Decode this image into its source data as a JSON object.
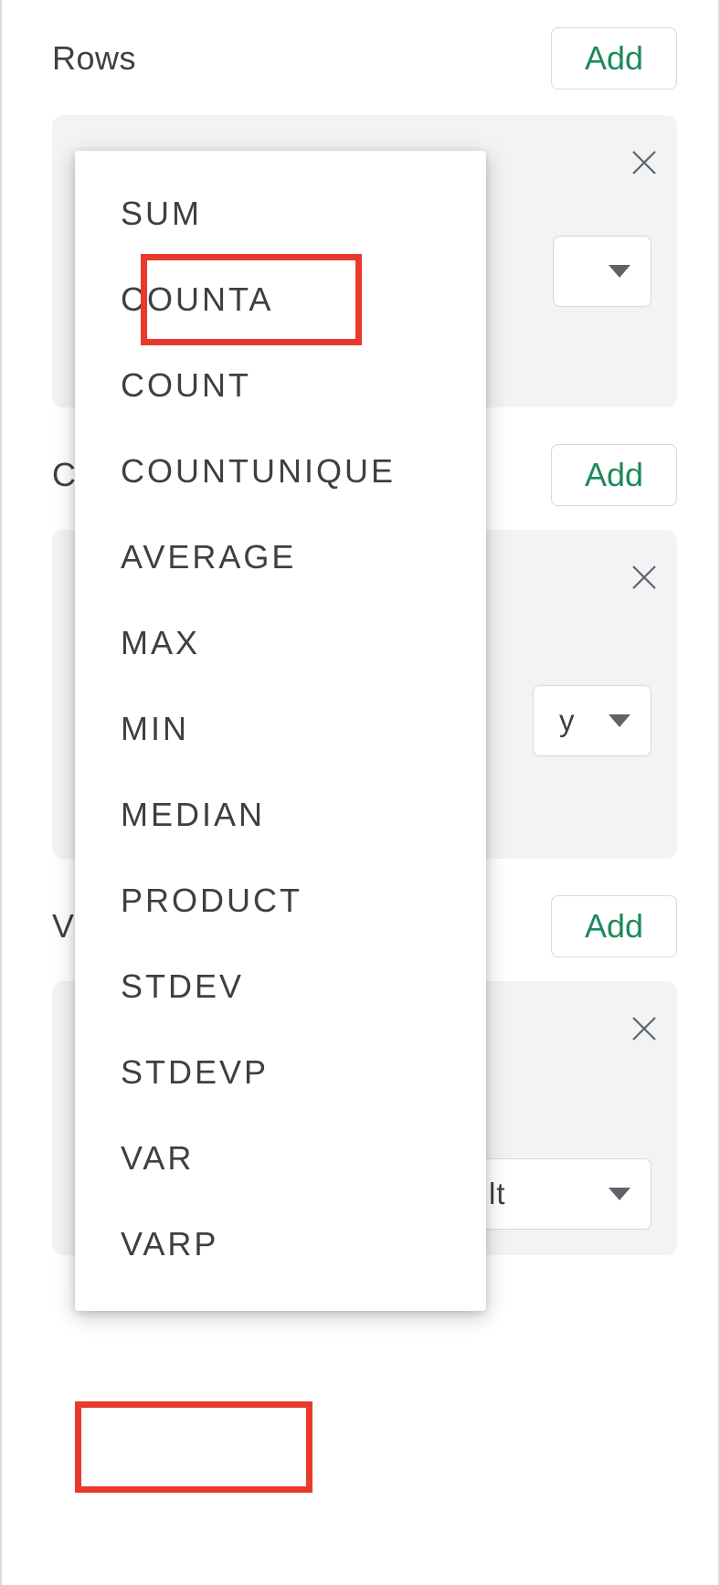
{
  "rows": {
    "title": "Rows",
    "add_label": "Add"
  },
  "columns": {
    "title_visible": "C",
    "add_label": "Add",
    "select_visible_fragment": "y"
  },
  "values": {
    "title_visible": "V",
    "add_label": "Add",
    "summarize_selected": "SUM",
    "showas_selected": "Default"
  },
  "dropdown": {
    "items": [
      "SUM",
      "COUNTA",
      "COUNT",
      "COUNTUNIQUE",
      "AVERAGE",
      "MAX",
      "MIN",
      "MEDIAN",
      "PRODUCT",
      "STDEV",
      "STDEVP",
      "VAR",
      "VARP"
    ],
    "highlighted_index": 1
  }
}
